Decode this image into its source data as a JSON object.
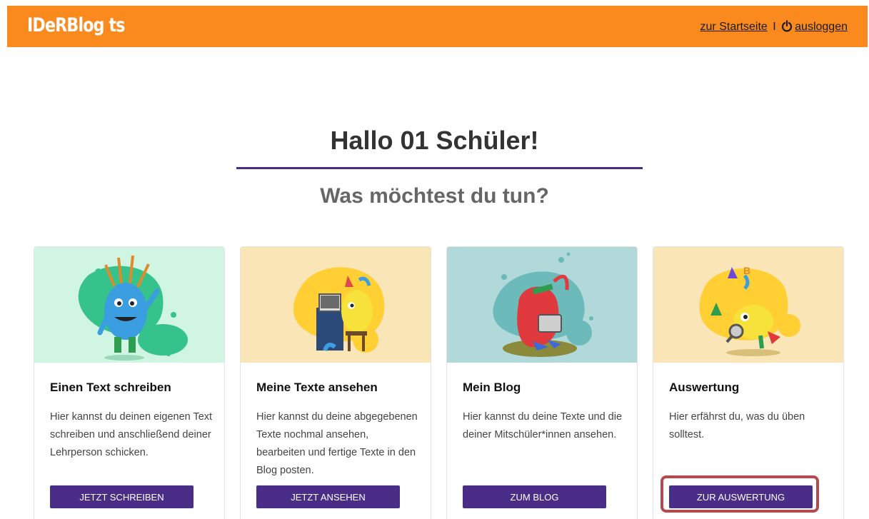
{
  "header": {
    "logo": "IDeRBlog ts",
    "links": {
      "home": "zur Startseite",
      "separator": "I",
      "logout": "ausloggen"
    },
    "bg_color": "#fb8a1e"
  },
  "main": {
    "greeting": "Hallo 01 Schüler!",
    "question": "Was möchtest du tun?",
    "accent_color": "#4a2d87"
  },
  "cards": [
    {
      "title": "Einen Text schreiben",
      "text": "Hier kannst du deinen eigenen Text schreiben und anschließend deiner Lehrperson schicken.",
      "button": "Jetzt schreiben",
      "image": "blue-monster-with-pencils-illustration",
      "bg": "#d0f6e3"
    },
    {
      "title": "Meine Texte ansehen",
      "text": "Hier kannst du deine abgegebenen Texte nochmal ansehen, bearbeiten und fertige Texte in den Blog posten.",
      "button": "Jetzt ansehen",
      "image": "yellow-monster-at-computer-illustration",
      "bg": "#f9e5b6"
    },
    {
      "title": "Mein Blog",
      "text": "Hier kannst du deine Texte und die deiner Mitschüler*innen ansehen.",
      "button": "Zum Blog",
      "image": "red-monster-reading-illustration",
      "bg": "#b2d9d9"
    },
    {
      "title": "Auswertung",
      "text": "Hier erfährst du, was du üben solltest.",
      "button": "Zur Auswertung",
      "image": "yellow-monster-with-magnifier-illustration",
      "bg": "#f9e5b6"
    }
  ]
}
